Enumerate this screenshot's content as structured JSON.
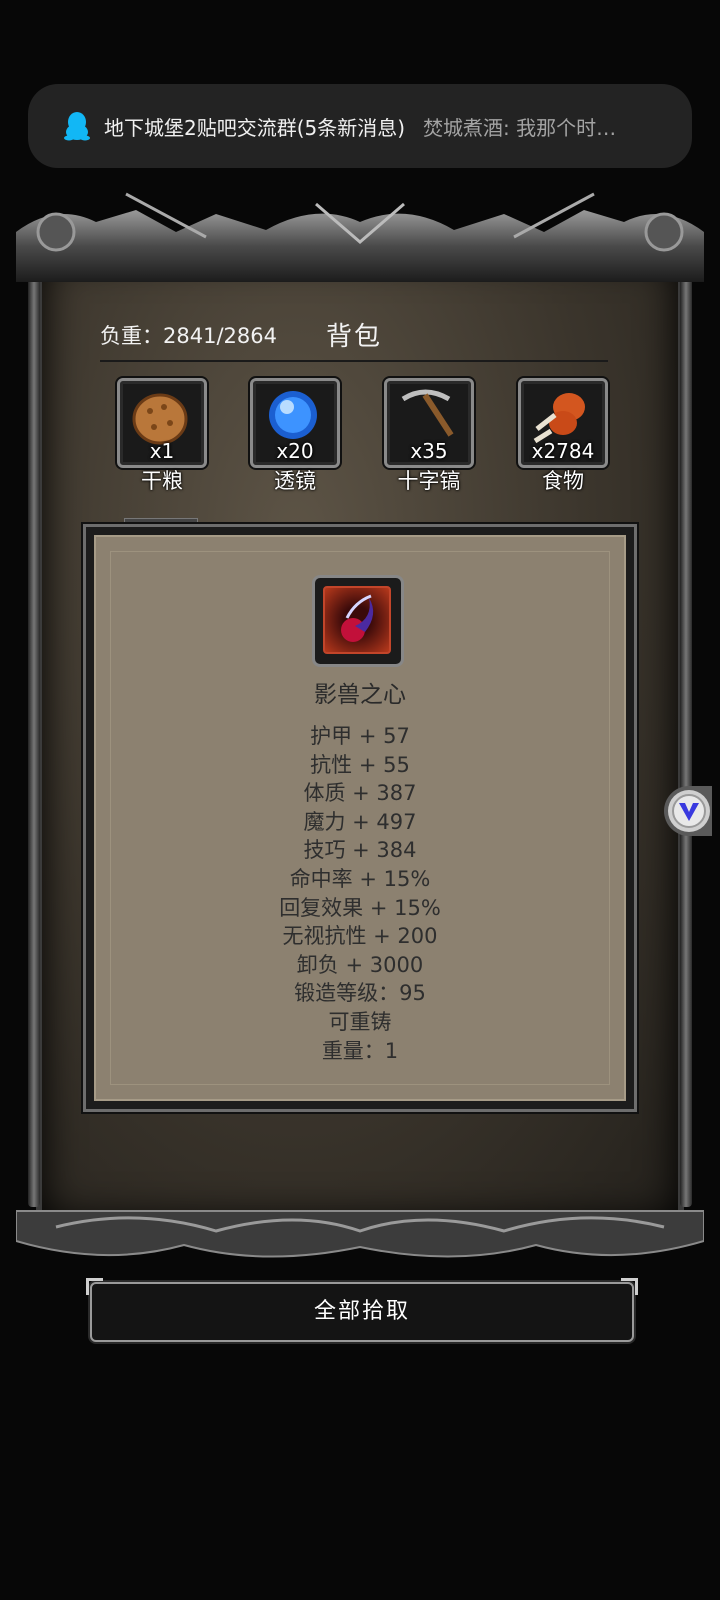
{
  "notification": {
    "app_icon": "qq-penguin-icon",
    "group": "地下城堡2贴吧交流群(5条新消息)",
    "message": "焚城煮酒: 我那个时…"
  },
  "bag": {
    "weight_label": "负重：2841/2864",
    "title": "背包",
    "items": [
      {
        "name": "干粮",
        "count": "x1",
        "icon": "bread-icon"
      },
      {
        "name": "透镜",
        "count": "x20",
        "icon": "lens-orb-icon"
      },
      {
        "name": "十字镐",
        "count": "x35",
        "icon": "pickaxe-icon"
      },
      {
        "name": "食物",
        "count": "x2784",
        "icon": "meat-drumstick-icon"
      }
    ]
  },
  "item_detail": {
    "icon": "beast-heart-icon",
    "name": "影兽之心",
    "stats": [
      "护甲 + 57",
      "抗性 + 55",
      "体质 + 387",
      "魔力 + 497",
      "技巧 + 384",
      "命中率 + 15%",
      "回复效果 + 15%",
      "无视抗性 + 200",
      "卸负 + 3000",
      "锻造等级：95",
      "可重铸",
      "重量：1"
    ]
  },
  "side_handle_icon": "vee-chevron-icon",
  "pickup_all_label": "全部拾取",
  "colors": {
    "background": "#070707",
    "panel": "#8c8170",
    "item_glow": "#c2452a"
  }
}
